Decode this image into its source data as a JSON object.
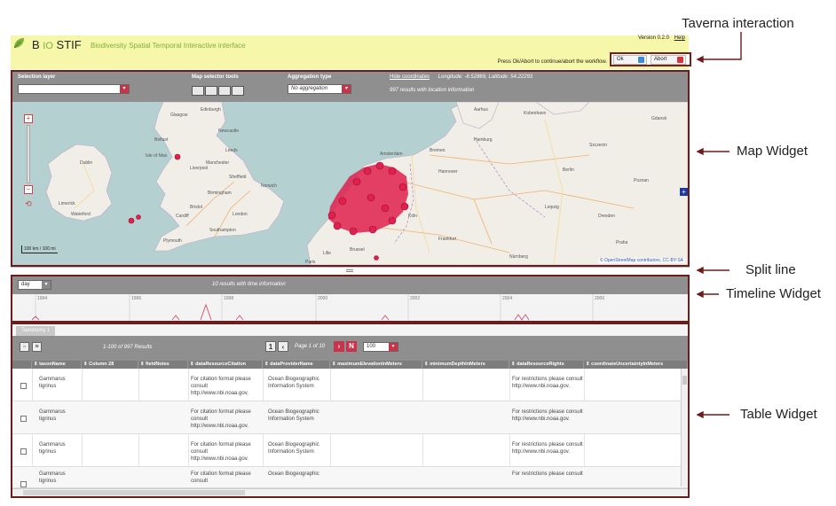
{
  "app": {
    "name_b": "B",
    "name_io": "IO",
    "name_stif": "STIF",
    "tagline": "Biodiversity Spatial Temporal Interactive interface",
    "version": "Version 0.2.0",
    "help": "Help",
    "prompt": "Press Ok/Abort to continue/abort the workflow.",
    "ok_label": "Ok",
    "abort_label": "Abort"
  },
  "map": {
    "selection_layer_label": "Selection layer",
    "map_tools_label": "Map selector tools",
    "aggregation_label": "Aggregation type",
    "aggregation_value": "No aggregation",
    "hide_coords": "Hide coordinates",
    "coords_text": "Longitude: -8.52869, Latitude: 54.22293",
    "results_text": "997 results with location information",
    "scale_text": "100 km / 100 mi",
    "attribution": "© OpenStreetMap contributors, CC-BY-SA",
    "labels": [
      "Dublin",
      "Limerick",
      "Waterford",
      "Belfast",
      "Isle of Man",
      "Liverpool",
      "Manchester",
      "Birmingham",
      "Cardiff",
      "London",
      "Bristol",
      "Plymouth",
      "Edinburgh",
      "Glasgow",
      "Newcastle",
      "Leeds",
      "Sheffield",
      "Norwich",
      "Southampton",
      "Amsterdam",
      "Hamburg",
      "Berlin",
      "Hannover",
      "Bremen",
      "Dresden",
      "Leipzig",
      "Köln",
      "Frankfurt",
      "Kobenhavn",
      "Aarhus",
      "Gdansk",
      "Poznan",
      "Praha",
      "Brussel",
      "Paris",
      "Lille",
      "Nürnberg",
      "Szczecin"
    ]
  },
  "timeline": {
    "granularity": "day",
    "note": "10 results with time information",
    "years": [
      "1994",
      "1996",
      "1998",
      "2000",
      "2002",
      "2004",
      "2006"
    ]
  },
  "table": {
    "tab_label": "Taxonomy 1",
    "results_count": "1-100 of 997 Results",
    "page_num": "1",
    "page_text": "Page 1 of 10",
    "page_last": "N",
    "per_page": "100",
    "columns": [
      "taxonName",
      "Column 28",
      "fieldNotes",
      "dataResourceCitation",
      "dataProviderName",
      "maximumElevationInMeters",
      "minimumDepthInMeters",
      "dataResourceRights",
      "coordinateUncertaintyInMeters"
    ],
    "rows": [
      {
        "taxon": "Gammarus tigrinus",
        "citation": "For citation format please consult http://www.nbi.noaa.gov.",
        "provider": "Ocean Biogeographic Information System",
        "rights": "For restrictions please consult http://www.nbi.noaa.gov."
      },
      {
        "taxon": "Gammarus tigrinus",
        "citation": "For citation format please consult http://www.nbi.noaa.gov.",
        "provider": "Ocean Biogeographic Information System",
        "rights": "For restrictions please consult http://www.nbi.noaa.gov."
      },
      {
        "taxon": "Gammarus tigrinus",
        "citation": "For citation format please consult http://www.nbi.noaa.gov.",
        "provider": "Ocean Biogeographic Information System",
        "rights": "For restrictions please consult http://www.nbi.noaa.gov."
      },
      {
        "taxon": "Gammarus tigrinus",
        "citation": "For citation format please consult",
        "provider": "Ocean Biogeographic",
        "rights": "For restrictions please consult"
      }
    ]
  },
  "annotations": {
    "taverna": "Taverna interaction",
    "map": "Map Widget",
    "split": "Split line",
    "timeline": "Timeline Widget",
    "table": "Table Widget"
  },
  "colors": {
    "header_bg": "#f6f7a8",
    "accent_red": "#c8344a",
    "panel_border": "#6b1c1c",
    "marker": "#e0204e"
  }
}
